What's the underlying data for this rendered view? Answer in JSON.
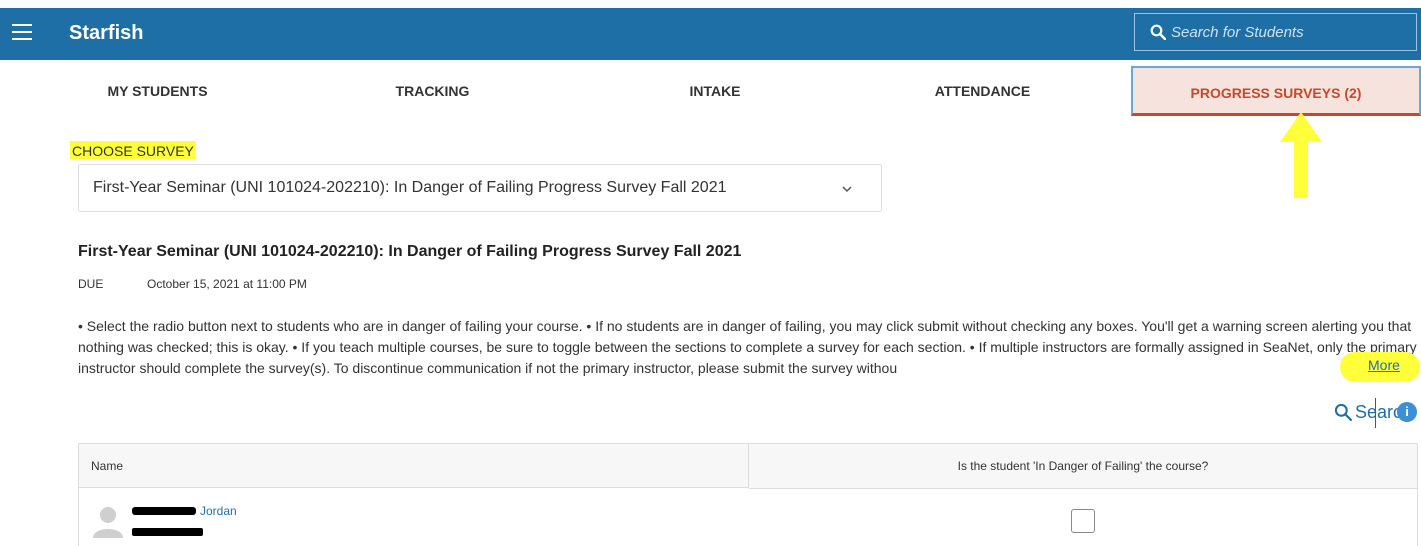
{
  "header": {
    "app_title": "Starfish",
    "search_placeholder": "Search for Students"
  },
  "tabs": [
    {
      "label": "MY STUDENTS"
    },
    {
      "label": "TRACKING"
    },
    {
      "label": "INTAKE"
    },
    {
      "label": "ATTENDANCE"
    },
    {
      "label": "PROGRESS SURVEYS (2)",
      "active": true
    }
  ],
  "survey": {
    "choose_label": "CHOOSE SURVEY",
    "selected": "First-Year Seminar (UNI 101024-202210): In Danger of Failing Progress Survey Fall 2021",
    "title": "First-Year Seminar (UNI 101024-202210): In Danger of Failing Progress Survey Fall 2021",
    "due_label": "DUE",
    "due_value": "October 15, 2021 at 11:00 PM",
    "description": "• Select the radio button next to students who are in danger of failing your course. • If no students are in danger of failing, you may click submit without checking any boxes. You'll get a warning screen alerting you that nothing was checked; this is okay. • If you teach multiple courses, be sure to toggle between the sections to complete a survey for each section. • If multiple instructors are formally assigned in SeaNet, only the primary instructor should complete the survey(s). To discontinue communication if not the primary instructor, please submit the survey withou",
    "more_label": "More",
    "search_label": "Search"
  },
  "table": {
    "columns": [
      "Name",
      "Is the student 'In Danger of Failing' the course?"
    ],
    "rows": [
      {
        "name": "Jordan",
        "in_danger": false
      }
    ]
  },
  "colors": {
    "header_bg": "#1f6fa7",
    "active_tab_text": "#c7482b",
    "active_tab_bg": "#f7e3dd",
    "highlight": "#ffff3a",
    "link": "#1f6fa7"
  }
}
